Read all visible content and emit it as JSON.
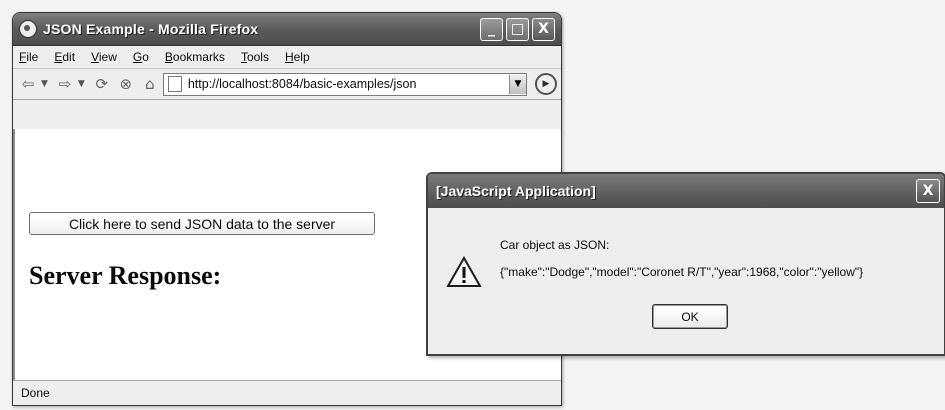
{
  "window": {
    "title": "JSON Example - Mozilla Firefox",
    "minimize_glyph": "_",
    "maximize_glyph": "□",
    "close_glyph": "X"
  },
  "menu": {
    "items": [
      {
        "underline": "F",
        "rest": "ile"
      },
      {
        "underline": "E",
        "rest": "dit"
      },
      {
        "underline": "V",
        "rest": "iew"
      },
      {
        "underline": "G",
        "rest": "o"
      },
      {
        "underline": "B",
        "rest": "ookmarks"
      },
      {
        "underline": "T",
        "rest": "ools"
      },
      {
        "underline": "H",
        "rest": "elp"
      }
    ]
  },
  "navigation": {
    "url": "http://localhost:8084/basic-examples/json",
    "icons": [
      "back-icon",
      "forward-icon",
      "reload-icon",
      "stop-icon",
      "home-icon",
      "page-icon",
      "go-icon"
    ]
  },
  "page": {
    "send_button_label": "Click here to send JSON data to the server",
    "response_heading": "Server Response:"
  },
  "status": {
    "text": "Done"
  },
  "dialog": {
    "title": "[JavaScript Application]",
    "close_glyph": "X",
    "message_line1": "Car object as JSON:",
    "message_line2": "{\"make\":\"Dodge\",\"model\":\"Coronet R/T\",\"year\":1968,\"color\":\"yellow\"}",
    "ok_label": "OK",
    "icon": "warning-icon"
  }
}
